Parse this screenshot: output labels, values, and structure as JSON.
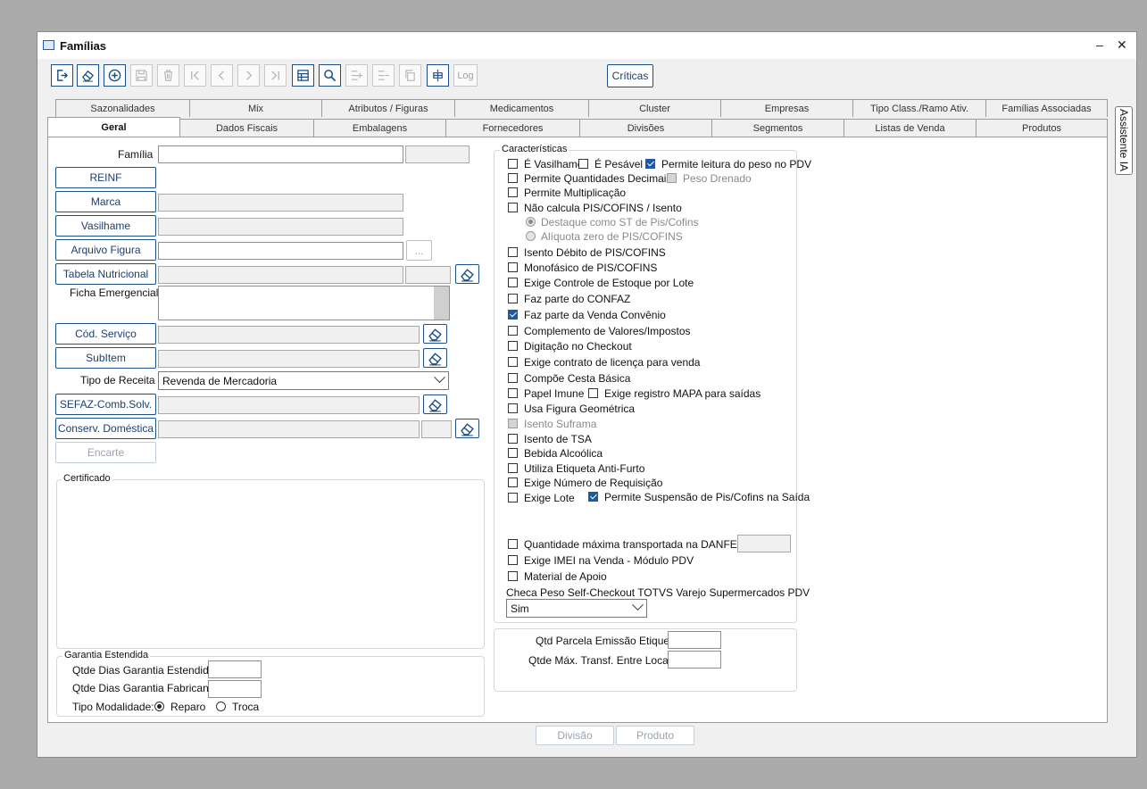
{
  "window": {
    "title": "Famílias",
    "minimize": "–",
    "close": "✕"
  },
  "toolbar": {
    "buttons": [
      {
        "name": "exit-icon",
        "enabled": true
      },
      {
        "name": "eraser-icon",
        "enabled": true
      },
      {
        "name": "add-icon",
        "enabled": true
      },
      {
        "name": "save-icon",
        "enabled": false
      },
      {
        "name": "delete-icon",
        "enabled": false
      },
      {
        "name": "first-icon",
        "enabled": false
      },
      {
        "name": "previous-icon",
        "enabled": false
      },
      {
        "name": "next-icon",
        "enabled": false
      },
      {
        "name": "last-icon",
        "enabled": false
      },
      {
        "name": "grid-icon",
        "enabled": true
      },
      {
        "name": "search-icon",
        "enabled": true
      },
      {
        "name": "add-row-icon",
        "enabled": false
      },
      {
        "name": "remove-row-icon",
        "enabled": false
      },
      {
        "name": "copy-icon",
        "enabled": false
      },
      {
        "name": "columns-icon",
        "enabled": true
      }
    ],
    "log_label": "Log",
    "criticas_label": "Críticas"
  },
  "tabs_top": [
    "Sazonalidades",
    "Mix",
    "Atributos / Figuras",
    "Medicamentos",
    "Cluster",
    "Empresas",
    "Tipo Class./Ramo Ativ.",
    "Famílias Associadas"
  ],
  "tabs_bottom": [
    "Geral",
    "Dados Fiscais",
    "Embalagens",
    "Fornecedores",
    "Divisões",
    "Segmentos",
    "Listas de Venda",
    "Produtos"
  ],
  "active_tab": "Geral",
  "side_tab": "Assistente IA",
  "form": {
    "familia_label": "Família",
    "reinf_label": "REINF",
    "marca_label": "Marca",
    "vasilhame_label": "Vasilhame",
    "arquivo_figura_label": "Arquivo Figura",
    "browse_label": "...",
    "tabela_nutricional_label": "Tabela Nutricional",
    "ficha_emergencial_label": "Ficha Emergencial",
    "cod_servico_label": "Cód. Serviço",
    "subitem_label": "SubItem",
    "tipo_receita_label": "Tipo de Receita",
    "tipo_receita_value": "Revenda de Mercadoria",
    "sefaz_label": "SEFAZ-Comb.Solv.",
    "conserv_label": "Conserv. Doméstica",
    "encarte_label": "Encarte"
  },
  "certificado": {
    "title": "Certificado"
  },
  "garantia": {
    "title": "Garantia Estendida",
    "dias_estendida_label": "Qtde Dias Garantia Estendida",
    "dias_fabricante_label": "Qtde Dias Garantia Fabricante",
    "modalidade_label": "Tipo Modalidade:",
    "reparo_label": "Reparo",
    "troca_label": "Troca",
    "selected": "Reparo"
  },
  "caracteristicas": {
    "title": "Características",
    "e_vasilhame": {
      "label": "É Vasilhame",
      "checked": false
    },
    "e_pesavel": {
      "label": "É Pesável",
      "checked": false
    },
    "permite_leitura_peso": {
      "label": "Permite leitura do peso no PDV",
      "checked": true
    },
    "permite_qtd_decimais": {
      "label": "Permite Quantidades Decimais",
      "checked": false
    },
    "peso_drenado": {
      "label": "Peso Drenado",
      "checked": false
    },
    "permite_multiplicacao": {
      "label": "Permite Multiplicação",
      "checked": false
    },
    "nao_calcula_pis": {
      "label": "Não calcula PIS/COFINS / Isento",
      "checked": false
    },
    "destaque_st": {
      "label": "Destaque como ST de Pis/Cofins",
      "checked": true
    },
    "aliquota_zero": {
      "label": "Alíquota zero de PIS/COFINS",
      "checked": false
    },
    "isento_debito": {
      "label": "Isento Débito de PIS/COFINS",
      "checked": false
    },
    "monofasico": {
      "label": "Monofásico de PIS/COFINS",
      "checked": false
    },
    "controle_estoque_lote": {
      "label": "Exige Controle de Estoque por Lote",
      "checked": false
    },
    "confaz": {
      "label": "Faz parte do CONFAZ",
      "checked": false
    },
    "venda_convenio": {
      "label": "Faz parte da Venda Convênio",
      "checked": true
    },
    "complemento_valores": {
      "label": "Complemento de Valores/Impostos",
      "checked": false
    },
    "digitacao_checkout": {
      "label": "Digitação no Checkout",
      "checked": false
    },
    "contrato_licenca": {
      "label": "Exige contrato de licença para venda",
      "checked": false
    },
    "cesta_basica": {
      "label": "Compõe Cesta Básica",
      "checked": false
    },
    "papel_imune": {
      "label": "Papel Imune",
      "checked": false
    },
    "registro_mapa": {
      "label": "Exige registro MAPA para saídas",
      "checked": false
    },
    "figura_geometrica": {
      "label": "Usa Figura Geométrica",
      "checked": false
    },
    "isento_suframa": {
      "label": "Isento Suframa",
      "checked": false
    },
    "isento_tsa": {
      "label": "Isento de TSA",
      "checked": false
    },
    "bebida_alcoolica": {
      "label": "Bebida Alcoólica",
      "checked": false
    },
    "etiqueta_antifurto": {
      "label": "Utiliza Etiqueta Anti-Furto",
      "checked": false
    },
    "numero_requisicao": {
      "label": "Exige Número de Requisição",
      "checked": false
    },
    "exige_lote": {
      "label": "Exige Lote",
      "checked": false
    },
    "suspensao_pis": {
      "label": "Permite Suspensão de Pis/Cofins na Saída",
      "checked": true
    },
    "qtd_max_danfe": {
      "label": "Quantidade máxima transportada na DANFE (KG)",
      "checked": false
    },
    "imei_venda": {
      "label": "Exige IMEI na Venda - Módulo PDV",
      "checked": false
    },
    "material_apoio": {
      "label": "Material de Apoio",
      "checked": false
    },
    "checa_peso_label": "Checa Peso Self-Checkout TOTVS Varejo Supermercados PDV",
    "checa_peso_value": "Sim"
  },
  "etiqueta": {
    "qtd_parcela_label": "Qtd Parcela Emissão Etiqueta",
    "qtde_max_transf_label": "Qtde Máx. Transf. Entre Locais"
  },
  "footer": {
    "divisao_label": "Divisão",
    "produto_label": "Produto"
  }
}
